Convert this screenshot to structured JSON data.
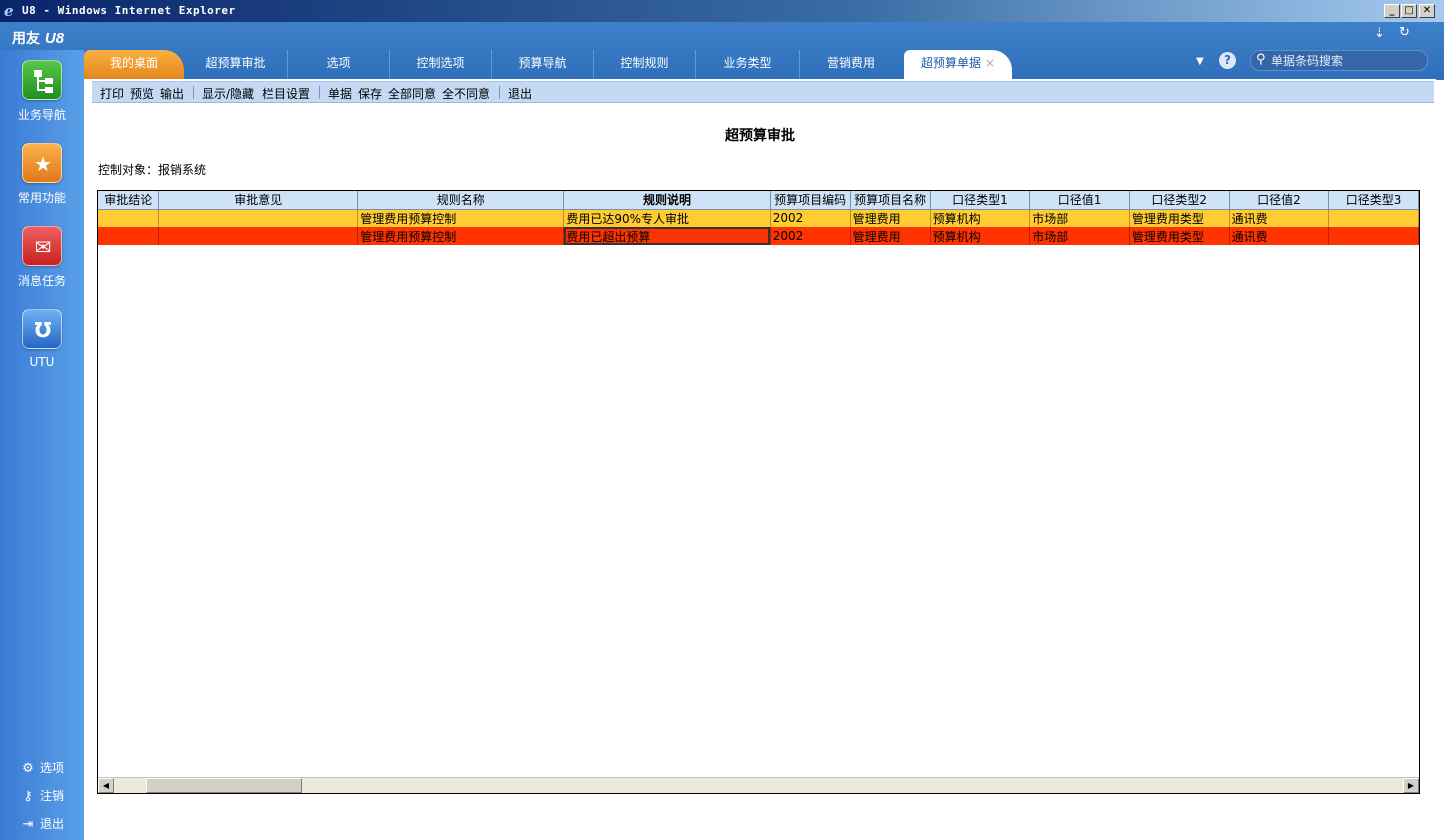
{
  "window": {
    "title": "U8 - Windows Internet Explorer"
  },
  "app": {
    "brand": "用友",
    "brand_suffix": "U8"
  },
  "tabs": [
    {
      "label": "我的桌面"
    },
    {
      "label": "超预算审批"
    },
    {
      "label": "选项"
    },
    {
      "label": "控制选项"
    },
    {
      "label": "预算导航"
    },
    {
      "label": "控制规则"
    },
    {
      "label": "业务类型"
    },
    {
      "label": "营销费用"
    },
    {
      "label": "超预算单据",
      "active": true
    }
  ],
  "search": {
    "placeholder": "单据条码搜索"
  },
  "sidebar": {
    "items": [
      {
        "label": "业务导航",
        "icon": "business-nav-icon"
      },
      {
        "label": "常用功能",
        "icon": "star-folder-icon"
      },
      {
        "label": "消息任务",
        "icon": "mail-icon"
      },
      {
        "label": "UTU",
        "icon": "utu-icon"
      }
    ],
    "bottom": [
      {
        "label": "选项",
        "icon": "gear-icon"
      },
      {
        "label": "注销",
        "icon": "key-icon"
      },
      {
        "label": "退出",
        "icon": "exit-icon"
      }
    ]
  },
  "toolbar": {
    "print": "打印",
    "preview": "预览",
    "output": "输出",
    "show_hide": "显示/隐藏",
    "column_settings": "栏目设置",
    "document": "单据",
    "save": "保存",
    "approve_all": "全部同意",
    "reject_all": "全不同意",
    "exit": "退出"
  },
  "page": {
    "title": "超预算审批",
    "control_object": "控制对象：报销系统"
  },
  "table": {
    "columns": [
      "审批结论",
      "审批意见",
      "规则名称",
      "规则说明",
      "预算项目编码",
      "预算项目名称",
      "口径类型1",
      "口径值1",
      "口径类型2",
      "口径值2",
      "口径类型3"
    ],
    "rows": [
      [
        "",
        "",
        "管理费用预算控制",
        "费用已达90%专人审批",
        "2002",
        "管理费用",
        "预算机构",
        "市场部",
        "管理费用类型",
        "通讯费",
        ""
      ],
      [
        "",
        "",
        "管理费用预算控制",
        "费用已超出预算",
        "2002",
        "管理费用",
        "预算机构",
        "市场部",
        "管理费用类型",
        "通讯费",
        ""
      ]
    ]
  },
  "colors": {
    "row_warning": "#ffcc33",
    "row_over": "#ff3300",
    "header_blue": "#3d80c9",
    "home_tab": "#f59a2a"
  }
}
